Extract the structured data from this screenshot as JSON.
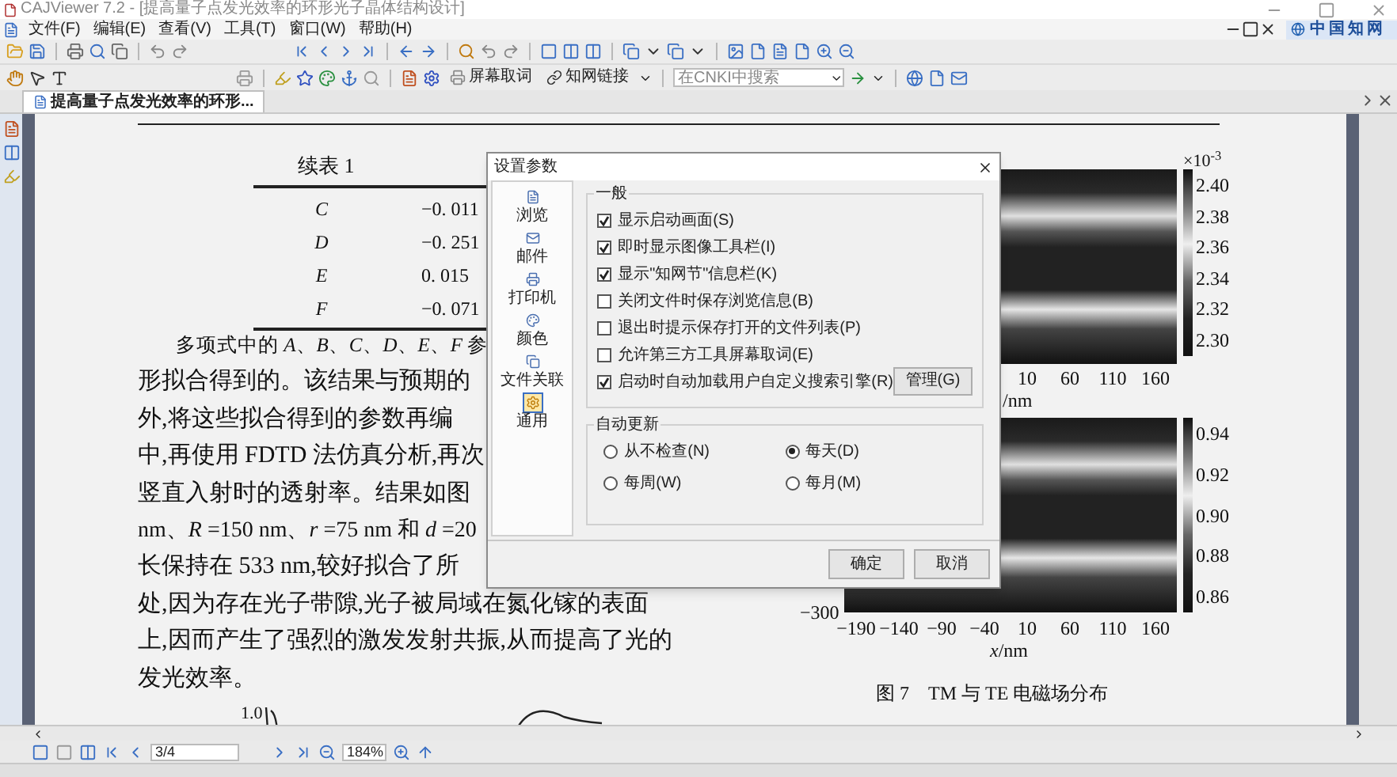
{
  "window": {
    "title": "CAJViewer 7.2 - [提高量子点发光效率的环形光子晶体结构设计]"
  },
  "menu": [
    "文件(F)",
    "编辑(E)",
    "查看(V)",
    "工具(T)",
    "窗口(W)",
    "帮助(H)"
  ],
  "brand": {
    "label": "中国知网"
  },
  "toolbar": {
    "buttons": [
      {
        "label": "屏幕取词"
      },
      {
        "label": "知网链接"
      }
    ],
    "search": {
      "placeholder": "在CNKI中搜索"
    }
  },
  "tabs": [
    {
      "label": "提高量子点发光效率的环形...",
      "selected": true
    }
  ],
  "document": {
    "table": {
      "title": "续表 1",
      "rows": [
        {
          "key": "C",
          "value": "−0. 011"
        },
        {
          "key": "D",
          "value": "−0. 251"
        },
        {
          "key": "E",
          "value": "0. 015"
        },
        {
          "key": "F",
          "value": "−0. 071"
        }
      ]
    },
    "paragraph": [
      "多项式中的 *A*、*B*、*C*、*D*、*E*、*F* 参",
      "形拟合得到的。该结果与预期的",
      "外,将这些拟合得到的参数再编",
      "中,再使用 FDTD 法仿真分析,再次",
      "竖直入射时的透射率。结果如图",
      "nm、*R* =150 nm、*r* =75 nm 和 *d* =20",
      "长保持在 533 nm,较好拟合了所",
      "处,因为存在光子带隙,光子被局域在氮化镓的表面",
      "上,因而产生了强烈的激发发射共振,从而提高了光的",
      "发光效率。"
    ],
    "figures": [
      {
        "scale_exponent": "×10$^{-3}$",
        "colorbar_ticks": [
          "2.40",
          "2.38",
          "2.36",
          "2.34",
          "2.32",
          "2.30"
        ],
        "x_ticks": [
          "10",
          "60",
          "110",
          "160"
        ],
        "x_label": "/nm"
      },
      {
        "y_label": "−300",
        "colorbar_ticks": [
          "0.94",
          "0.92",
          "0.90",
          "0.88",
          "0.86"
        ],
        "x_ticks": [
          "−190",
          "−140",
          "−90",
          "−40",
          "10",
          "60",
          "110",
          "160"
        ],
        "x_label": "*x*/nm"
      }
    ],
    "caption": "图 7　TM 与 TE 电磁场分布",
    "plot_label": "1.0"
  },
  "dialog": {
    "title": "设置参数",
    "categories": [
      {
        "label": "浏览",
        "selected": false
      },
      {
        "label": "邮件",
        "selected": false
      },
      {
        "label": "打印机",
        "selected": false
      },
      {
        "label": "颜色",
        "selected": false
      },
      {
        "label": "文件关联",
        "selected": false
      },
      {
        "label": "通用",
        "selected": true
      }
    ],
    "general": {
      "title": "一般",
      "options": [
        {
          "label": "显示启动画面(S)",
          "checked": true
        },
        {
          "label": "即时显示图像工具栏(I)",
          "checked": true
        },
        {
          "label": "显示\"知网节\"信息栏(K)",
          "checked": true
        },
        {
          "label": "关闭文件时保存浏览信息(B)",
          "checked": false
        },
        {
          "label": "退出时提示保存打开的文件列表(P)",
          "checked": false
        },
        {
          "label": "允许第三方工具屏幕取词(E)",
          "checked": false
        },
        {
          "label": "启动时自动加载用户自定义搜索引擎(R)",
          "checked": true
        }
      ],
      "manage_button": "管理(G)"
    },
    "update": {
      "title": "自动更新",
      "options": [
        {
          "label": "从不检查(N)",
          "selected": false
        },
        {
          "label": "每天(D)",
          "selected": true
        },
        {
          "label": "每周(W)",
          "selected": false
        },
        {
          "label": "每月(M)",
          "selected": false
        }
      ]
    },
    "buttons": [
      "确定",
      "取消"
    ]
  },
  "nav": {
    "page": "3/4",
    "zoom": "184%"
  }
}
